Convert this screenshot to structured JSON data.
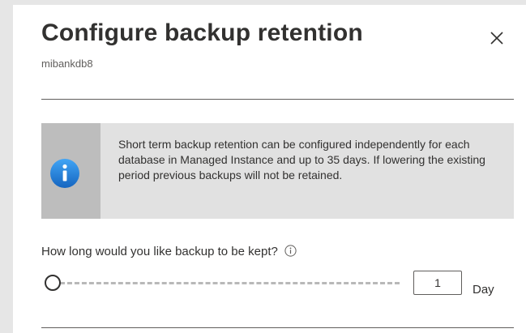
{
  "header": {
    "title": "Configure backup retention",
    "subtitle": "mibankdb8",
    "close_icon": "close-icon"
  },
  "info": {
    "icon": "info-icon",
    "message": "Short term backup retention can be configured independently for each database in Managed Instance and up to 35 days. If lowering the existing period previous backups will not be retained.",
    "accent_color": "#1e88e5"
  },
  "retention": {
    "question": "How long would you like backup to be kept?",
    "help_icon": "info-circle-icon",
    "value": "1",
    "unit": "Day",
    "slider_level": 0
  }
}
